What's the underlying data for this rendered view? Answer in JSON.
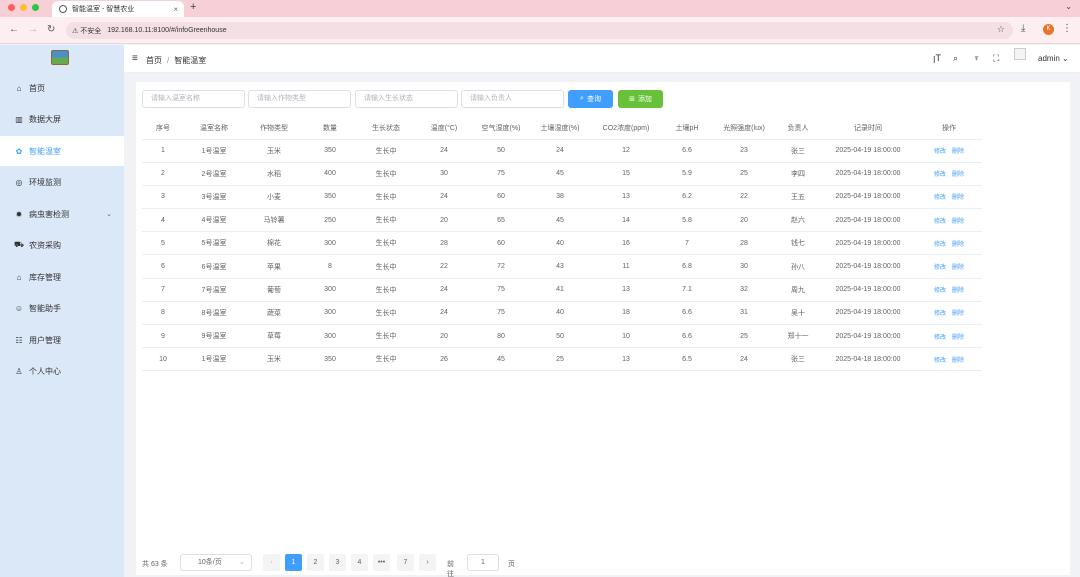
{
  "browser": {
    "tab_title": "智能温室 - 智慧农业",
    "new_tab": "+",
    "security": "不安全",
    "url": "192.168.10.11:8100/#/infoGreenhouse",
    "profile_initial": "K"
  },
  "sidebar": {
    "items": [
      {
        "label": "首页",
        "icon": "⌂"
      },
      {
        "label": "数据大屏",
        "icon": "▥"
      },
      {
        "label": "智能温室",
        "icon": "✿"
      },
      {
        "label": "环境监测",
        "icon": "◎"
      },
      {
        "label": "病虫害检测",
        "icon": "✹"
      },
      {
        "label": "农资采购",
        "icon": "⛟"
      },
      {
        "label": "库存管理",
        "icon": "⌂"
      },
      {
        "label": "智能助手",
        "icon": "☺"
      },
      {
        "label": "用户管理",
        "icon": "☷"
      },
      {
        "label": "个人中心",
        "icon": "♙"
      }
    ],
    "active_index": 2
  },
  "header": {
    "breadcrumb_home": "首页",
    "breadcrumb_sep": "/",
    "breadcrumb_current": "智能温室",
    "username": "admin"
  },
  "filters": {
    "greenhouse_name_placeholder": "请输入温室名称",
    "crop_type_placeholder": "请输入作物类型",
    "growth_status_placeholder": "请输入生长状态",
    "manager_placeholder": "请输入负责人",
    "query_label": "查询",
    "add_label": "添加"
  },
  "table": {
    "columns": [
      "序号",
      "温室名称",
      "作物类型",
      "数量",
      "生长状态",
      "温度(°C)",
      "空气湿度(%)",
      "土壤湿度(%)",
      "CO2浓度(ppm)",
      "土壤pH",
      "光照强度(lux)",
      "负责人",
      "记录时间",
      "操作"
    ],
    "edit_label": "修改",
    "delete_label": "删除",
    "rows": [
      [
        "1",
        "1号温室",
        "玉米",
        "350",
        "生长中",
        "24",
        "50",
        "24",
        "12",
        "6.6",
        "23",
        "张三",
        "2025-04-19 18:00:00"
      ],
      [
        "2",
        "2号温室",
        "水稻",
        "400",
        "生长中",
        "30",
        "75",
        "45",
        "15",
        "5.9",
        "25",
        "李四",
        "2025-04-19 18:00:00"
      ],
      [
        "3",
        "3号温室",
        "小麦",
        "350",
        "生长中",
        "24",
        "60",
        "38",
        "13",
        "6.2",
        "22",
        "王五",
        "2025-04-19 18:00:00"
      ],
      [
        "4",
        "4号温室",
        "马铃薯",
        "250",
        "生长中",
        "20",
        "65",
        "45",
        "14",
        "5.8",
        "20",
        "赵六",
        "2025-04-19 18:00:00"
      ],
      [
        "5",
        "5号温室",
        "棉花",
        "300",
        "生长中",
        "28",
        "60",
        "40",
        "16",
        "7",
        "28",
        "钱七",
        "2025-04-19 18:00:00"
      ],
      [
        "6",
        "6号温室",
        "苹果",
        "8",
        "生长中",
        "22",
        "72",
        "43",
        "11",
        "6.8",
        "30",
        "孙八",
        "2025-04-19 18:00:00"
      ],
      [
        "7",
        "7号温室",
        "葡萄",
        "300",
        "生长中",
        "24",
        "75",
        "41",
        "13",
        "7.1",
        "32",
        "周九",
        "2025-04-19 18:00:00"
      ],
      [
        "8",
        "8号温室",
        "蔬菜",
        "300",
        "生长中",
        "24",
        "75",
        "40",
        "18",
        "6.6",
        "31",
        "吴十",
        "2025-04-19 18:00:00"
      ],
      [
        "9",
        "9号温室",
        "草莓",
        "300",
        "生长中",
        "20",
        "80",
        "50",
        "10",
        "6.6",
        "25",
        "郑十一",
        "2025-04-19 18:00:00"
      ],
      [
        "10",
        "1号温室",
        "玉米",
        "350",
        "生长中",
        "26",
        "45",
        "25",
        "13",
        "6.5",
        "24",
        "张三",
        "2025-04-18 18:00:00"
      ]
    ]
  },
  "pagination": {
    "total": "共 63 条",
    "page_size": "10条/页",
    "prev": "‹",
    "pages": [
      "1",
      "2",
      "3",
      "4",
      "•••",
      "7"
    ],
    "next": "›",
    "goto_label": "前往",
    "goto_value": "1",
    "page_suffix": "页"
  },
  "colors": {
    "primary": "#409eff",
    "success": "#67c23a",
    "sidebar_bg": "#dbe8f7",
    "tabbar_bg": "#f7cfd6"
  }
}
